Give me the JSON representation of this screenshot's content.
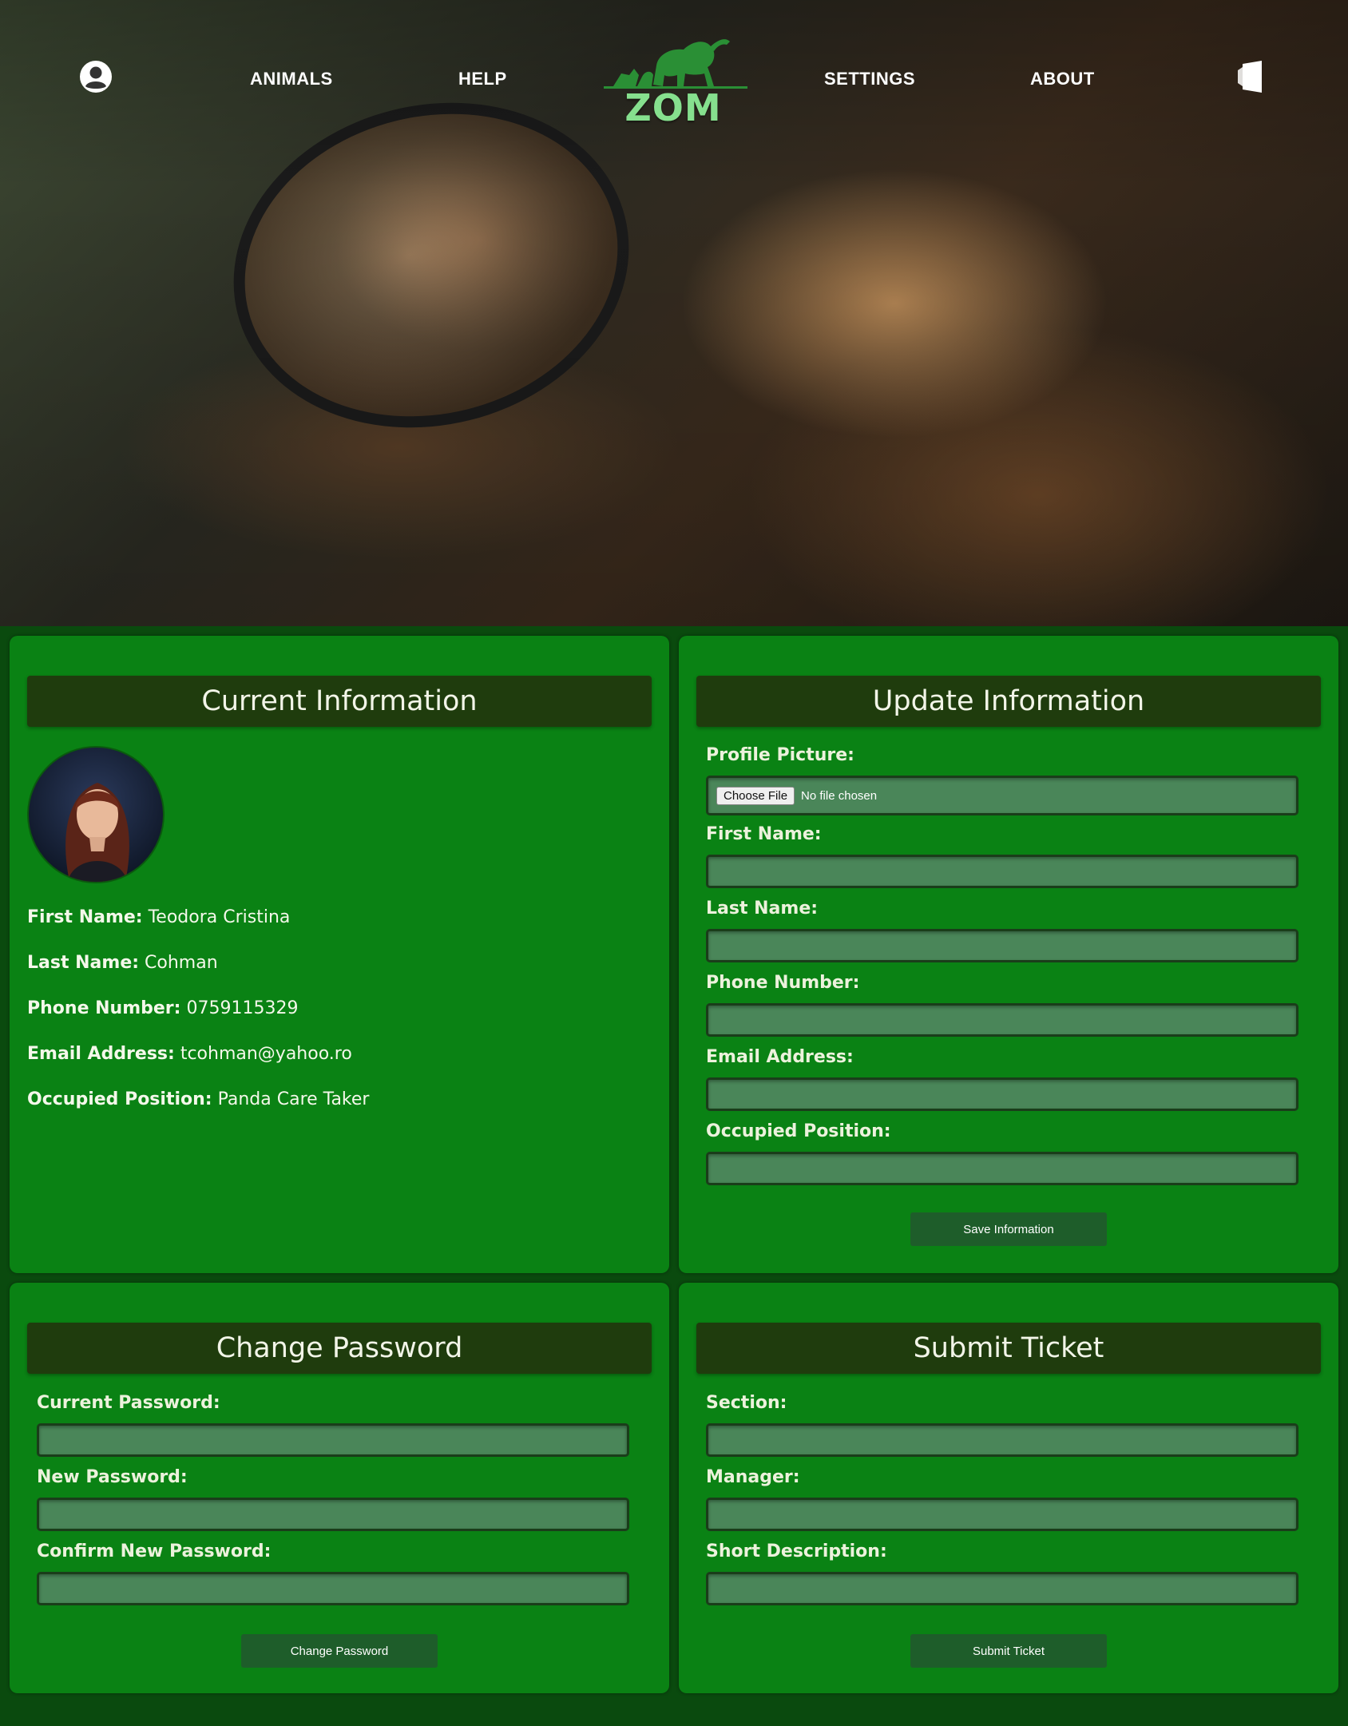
{
  "nav": {
    "links": [
      "ANIMALS",
      "HELP",
      "SETTINGS",
      "ABOUT"
    ],
    "logo_text": "ZOM",
    "profile_icon": "user-circle-icon",
    "logout_icon": "door-exit-icon"
  },
  "current_info": {
    "title": "Current Information",
    "fields": [
      {
        "label": "First Name:",
        "value": "Teodora Cristina"
      },
      {
        "label": "Last Name:",
        "value": "Cohman"
      },
      {
        "label": "Phone Number:",
        "value": "0759115329"
      },
      {
        "label": "Email Address:",
        "value": "tcohman@yahoo.ro"
      },
      {
        "label": "Occupied Position:",
        "value": "Panda Care Taker"
      }
    ]
  },
  "update_info": {
    "title": "Update Information",
    "profile_picture_label": "Profile Picture:",
    "choose_file_label": "Choose File",
    "file_status": "No file chosen",
    "labels": [
      "First Name:",
      "Last Name:",
      "Phone Number:",
      "Email Address:",
      "Occupied Position:"
    ],
    "values": [
      "",
      "",
      "",
      "",
      ""
    ],
    "save_button": "Save Information"
  },
  "change_password": {
    "title": "Change Password",
    "labels": [
      "Current Password:",
      "New Password:",
      "Confirm New Password:"
    ],
    "values": [
      "",
      "",
      ""
    ],
    "button": "Change Password"
  },
  "submit_ticket": {
    "title": "Submit Ticket",
    "labels": [
      "Section:",
      "Manager:",
      "Short Description:"
    ],
    "values": [
      "",
      "",
      ""
    ],
    "button": "Submit Ticket"
  },
  "colors": {
    "page_bg": "#0a4a0e",
    "panel_bg": "#0a8214",
    "panel_header_bg": "#1f3c0d",
    "input_bg": "#4a8659",
    "button_bg": "#1e5d2a",
    "logo_green": "#86e08e"
  }
}
